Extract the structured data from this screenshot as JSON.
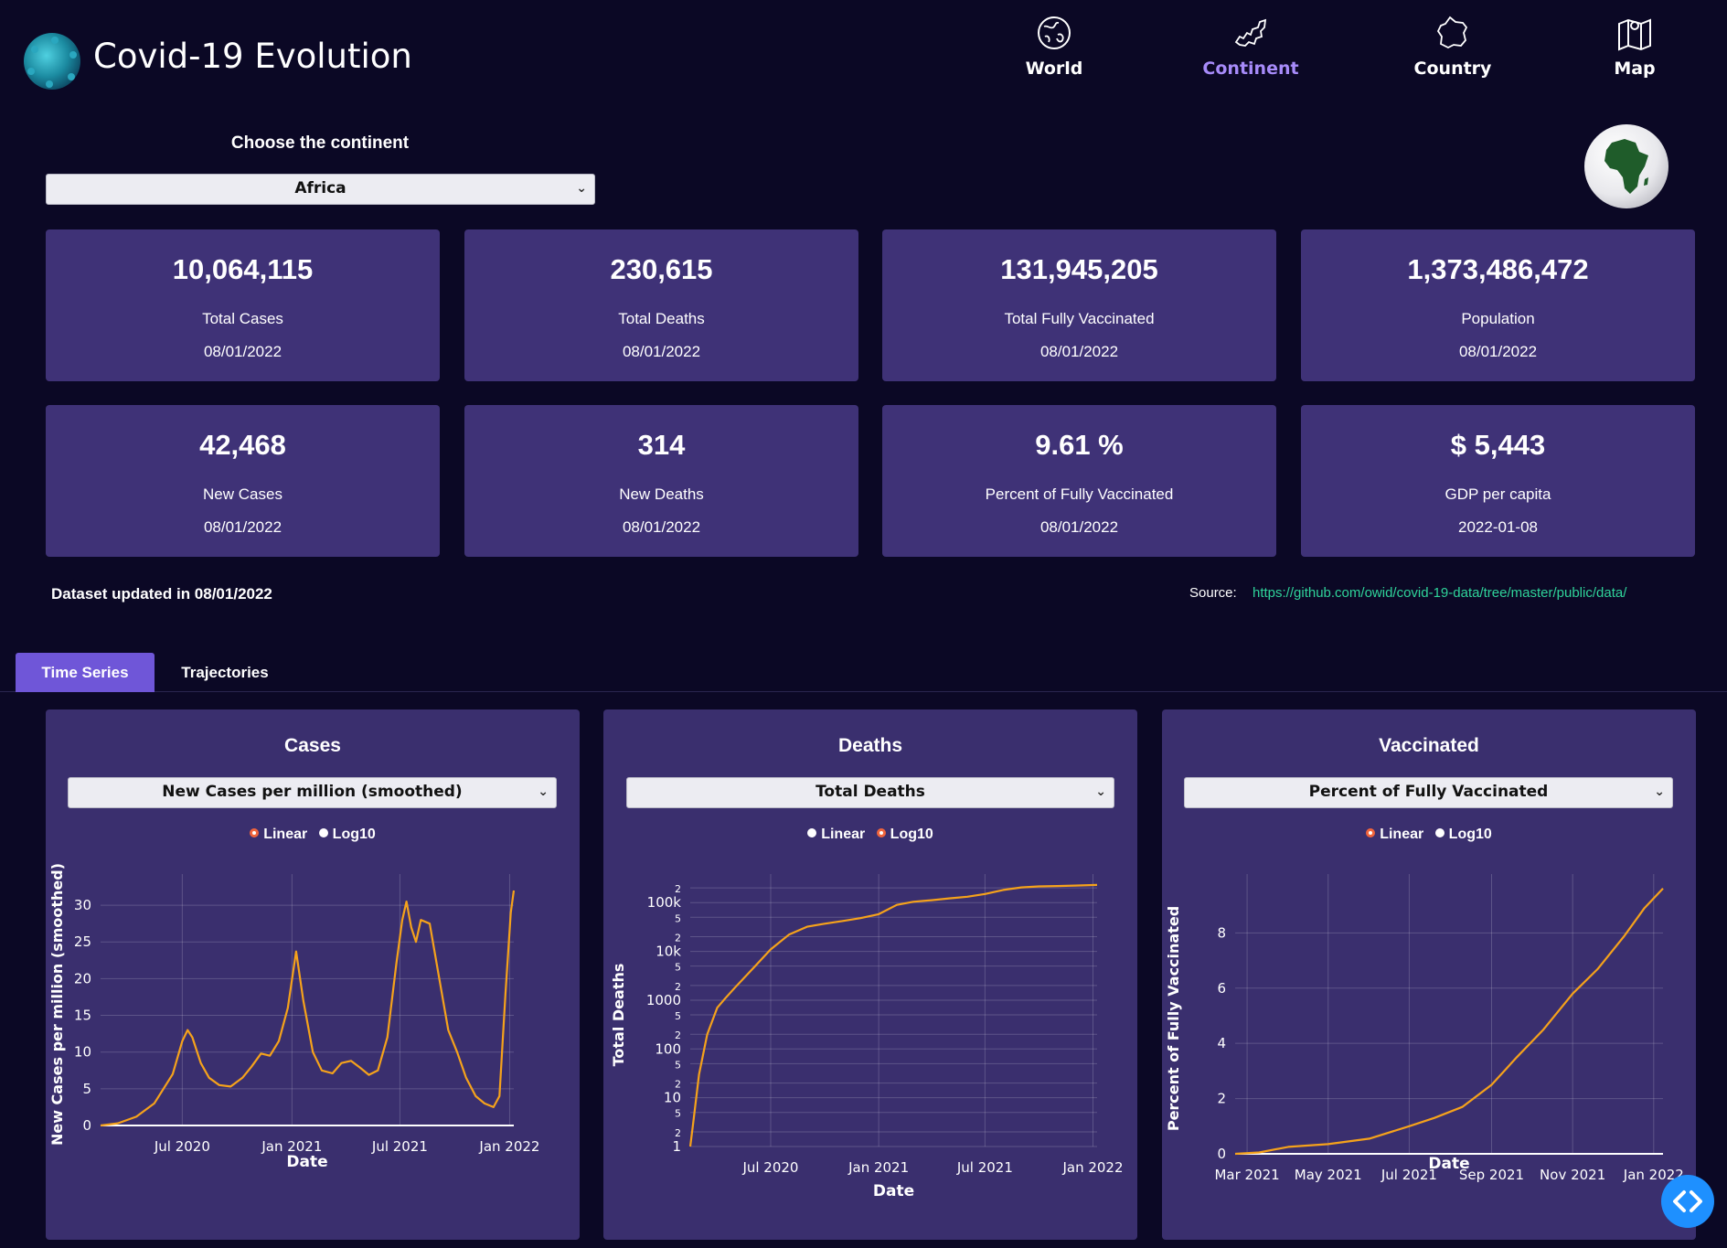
{
  "header": {
    "title": "Covid-19 Evolution",
    "nav": [
      {
        "label": "World",
        "icon": "globe-icon"
      },
      {
        "label": "Continent",
        "icon": "continent-icon"
      },
      {
        "label": "Country",
        "icon": "france-icon"
      },
      {
        "label": "Map",
        "icon": "map-icon"
      }
    ],
    "active_nav": "Continent",
    "active_color": "#a78bfa"
  },
  "selector": {
    "label": "Choose the continent",
    "value": "Africa"
  },
  "kpis": [
    {
      "value": "10,064,115",
      "label": "Total Cases",
      "date": "08/01/2022"
    },
    {
      "value": "230,615",
      "label": "Total Deaths",
      "date": "08/01/2022"
    },
    {
      "value": "131,945,205",
      "label": "Total Fully Vaccinated",
      "date": "08/01/2022"
    },
    {
      "value": "1,373,486,472",
      "label": "Population",
      "date": "08/01/2022"
    },
    {
      "value": "42,468",
      "label": "New Cases",
      "date": "08/01/2022"
    },
    {
      "value": "314",
      "label": "New Deaths",
      "date": "08/01/2022"
    },
    {
      "value": "9.61 %",
      "label": "Percent of Fully Vaccinated",
      "date": "08/01/2022"
    },
    {
      "value": "$ 5,443",
      "label": "GDP per capita",
      "date": "2022-01-08"
    }
  ],
  "footer": {
    "updated": "Dataset updated in 08/01/2022",
    "source_label": "Source:",
    "source_url": "https://github.com/owid/covid-19-data/tree/master/public/data/"
  },
  "tabs": [
    {
      "label": "Time Series",
      "active": true
    },
    {
      "label": "Trajectories",
      "active": false
    }
  ],
  "panels": [
    {
      "title": "Cases",
      "select": "New Cases per million (smoothed)",
      "scale": [
        "Linear",
        "Log10"
      ],
      "selected_scale": "Linear"
    },
    {
      "title": "Deaths",
      "select": "Total Deaths",
      "scale": [
        "Linear",
        "Log10"
      ],
      "selected_scale": "Log10"
    },
    {
      "title": "Vaccinated",
      "select": "Percent of Fully Vaccinated",
      "scale": [
        "Linear",
        "Log10"
      ],
      "selected_scale": "Linear"
    }
  ],
  "colors": {
    "line": "#f5a21b",
    "card": "#3f3277",
    "panel": "#3a2f6e",
    "tab_active": "#6f56d8",
    "link": "#2fd39a"
  },
  "chart_data": [
    {
      "type": "line",
      "title": "",
      "xlabel": "Date",
      "ylabel": "New Cases per million (smoothed)",
      "x_ticks": [
        "Jul 2020",
        "Jan 2021",
        "Jul 2021",
        "Jan 2022"
      ],
      "y_ticks": [
        0,
        5,
        10,
        15,
        20,
        25,
        30
      ],
      "xlim": [
        "2020-02-15",
        "2022-01-08"
      ],
      "ylim": [
        0,
        33
      ],
      "series": [
        {
          "x": [
            "2020-02-15",
            "2020-03-15",
            "2020-04-15",
            "2020-05-15",
            "2020-06-15",
            "2020-07-01",
            "2020-07-10",
            "2020-07-18",
            "2020-08-01",
            "2020-08-15",
            "2020-09-01",
            "2020-09-20",
            "2020-10-10",
            "2020-10-25",
            "2020-11-10",
            "2020-11-25",
            "2020-12-10",
            "2020-12-25",
            "2021-01-08",
            "2021-01-20",
            "2021-02-05",
            "2021-02-20",
            "2021-03-10",
            "2021-03-25",
            "2021-04-10",
            "2021-04-25",
            "2021-05-10",
            "2021-05-25",
            "2021-06-10",
            "2021-06-25",
            "2021-07-05",
            "2021-07-12",
            "2021-07-20",
            "2021-07-28",
            "2021-08-05",
            "2021-08-20",
            "2021-09-05",
            "2021-09-20",
            "2021-10-05",
            "2021-10-20",
            "2021-11-05",
            "2021-11-20",
            "2021-12-05",
            "2021-12-15",
            "2021-12-25",
            "2022-01-03",
            "2022-01-08"
          ],
          "y": [
            0,
            0.3,
            1.2,
            3,
            7,
            11.5,
            13,
            12,
            8.5,
            6.5,
            5.5,
            5.3,
            6.5,
            8,
            9.8,
            9.5,
            11.5,
            16,
            23.7,
            17,
            10,
            7.5,
            7.1,
            8.5,
            8.8,
            7.9,
            6.9,
            7.5,
            12,
            22,
            28,
            30.5,
            27,
            25,
            28,
            27.5,
            20,
            13,
            10,
            6.5,
            4,
            3,
            2.5,
            4,
            18,
            29,
            32
          ]
        }
      ]
    },
    {
      "type": "line",
      "title": "",
      "xlabel": "Date",
      "ylabel": "Total Deaths",
      "log_y": true,
      "x_ticks": [
        "Jul 2020",
        "Jan 2021",
        "Jul 2021",
        "Jan 2022"
      ],
      "y_ticks": [
        "1",
        "2",
        "5",
        "10",
        "2",
        "5",
        "100",
        "2",
        "5",
        "1000",
        "2",
        "5",
        "10k",
        "2",
        "5",
        "100k",
        "2"
      ],
      "xlim": [
        "2020-02-15",
        "2022-01-08"
      ],
      "ylim": [
        1,
        250000
      ],
      "series": [
        {
          "x": [
            "2020-02-15",
            "2020-02-20",
            "2020-03-01",
            "2020-03-15",
            "2020-04-01",
            "2020-04-15",
            "2020-05-01",
            "2020-06-01",
            "2020-07-01",
            "2020-08-01",
            "2020-09-01",
            "2020-10-01",
            "2020-11-01",
            "2020-12-01",
            "2021-01-01",
            "2021-02-01",
            "2021-03-01",
            "2021-04-01",
            "2021-05-01",
            "2021-06-01",
            "2021-07-01",
            "2021-08-01",
            "2021-09-01",
            "2021-10-01",
            "2021-11-01",
            "2021-12-01",
            "2022-01-08"
          ],
          "y": [
            1,
            3,
            30,
            200,
            700,
            1100,
            1800,
            4500,
            11000,
            22000,
            32000,
            37000,
            42000,
            48000,
            58000,
            90000,
            104000,
            112000,
            122000,
            132000,
            150000,
            182000,
            205000,
            215000,
            219000,
            223000,
            230615
          ]
        }
      ]
    },
    {
      "type": "line",
      "title": "",
      "xlabel": "Date",
      "ylabel": "Percent of Fully Vaccinated",
      "x_ticks": [
        "Mar 2021",
        "May 2021",
        "Jul 2021",
        "Sep 2021",
        "Nov 2021",
        "Jan 2022"
      ],
      "y_ticks": [
        0,
        2,
        4,
        6,
        8
      ],
      "xlim": [
        "2021-02-20",
        "2022-01-08"
      ],
      "ylim": [
        0,
        9.8
      ],
      "series": [
        {
          "x": [
            "2021-02-20",
            "2021-03-10",
            "2021-04-01",
            "2021-05-01",
            "2021-06-01",
            "2021-07-01",
            "2021-07-20",
            "2021-08-10",
            "2021-09-01",
            "2021-09-20",
            "2021-10-10",
            "2021-11-01",
            "2021-11-20",
            "2021-12-10",
            "2021-12-25",
            "2022-01-08"
          ],
          "y": [
            0,
            0.05,
            0.25,
            0.35,
            0.55,
            1.0,
            1.3,
            1.7,
            2.5,
            3.5,
            4.5,
            5.8,
            6.7,
            7.9,
            8.9,
            9.61
          ]
        }
      ]
    }
  ]
}
